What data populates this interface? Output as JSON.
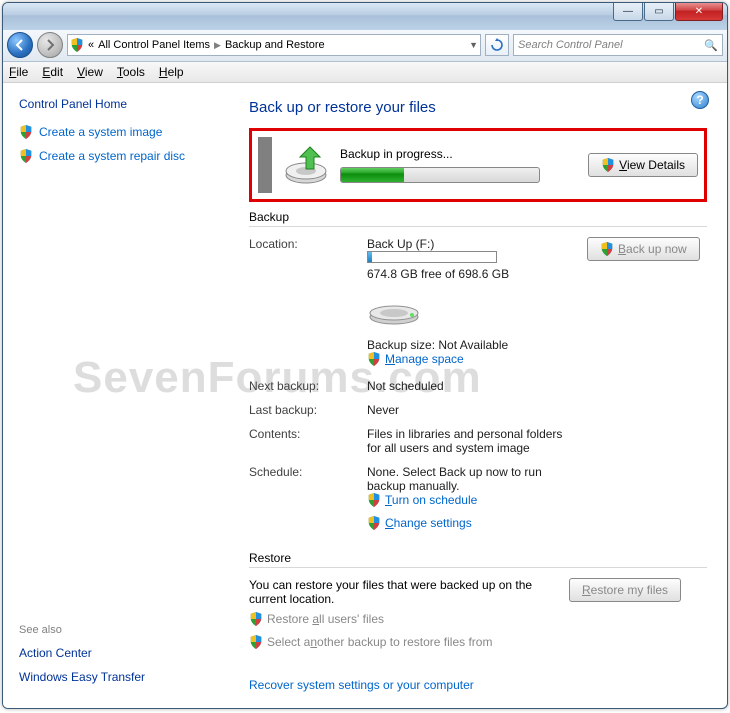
{
  "titlebar": {
    "min": "—",
    "max": "▭",
    "close": "✕"
  },
  "nav": {
    "crumb_prefix": "«",
    "crumb1": "All Control Panel Items",
    "crumb2": "Backup and Restore",
    "search_placeholder": "Search Control Panel"
  },
  "menu": {
    "file": "File",
    "edit": "Edit",
    "view": "View",
    "tools": "Tools",
    "help": "Help"
  },
  "sidebar": {
    "home": "Control Panel Home",
    "task1": "Create a system image",
    "task2": "Create a system repair disc",
    "seealso": "See also",
    "link1": "Action Center",
    "link2": "Windows Easy Transfer"
  },
  "main": {
    "heading": "Back up or restore your files",
    "progress_label": "Backup in progress...",
    "view_details": "View Details",
    "backup_section": "Backup",
    "location_label": "Location:",
    "location_value": "Back Up (F:)",
    "disk_free": "674.8 GB free of 698.6 GB",
    "backup_size": "Backup size: Not Available",
    "manage_space": "Manage space",
    "backup_now": "Back up now",
    "next_backup_label": "Next backup:",
    "next_backup_value": "Not scheduled",
    "last_backup_label": "Last backup:",
    "last_backup_value": "Never",
    "contents_label": "Contents:",
    "contents_value": "Files in libraries and personal folders for all users and system image",
    "schedule_label": "Schedule:",
    "schedule_value": "None. Select Back up now to run backup manually.",
    "turn_on_schedule": "Turn on schedule",
    "change_settings": "Change settings",
    "restore_section": "Restore",
    "restore_text": "You can restore your files that were backed up on the current location.",
    "restore_my_files": "Restore my files",
    "restore_all": "Restore all users' files",
    "select_another": "Select another backup to restore files from",
    "recover": "Recover system settings or your computer"
  },
  "watermark": "SevenForums.com"
}
